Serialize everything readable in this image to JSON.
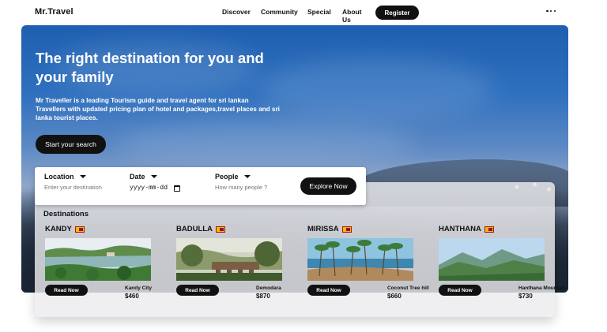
{
  "nav": {
    "brand": "Mr.Travel",
    "links": [
      "Discover",
      "Community",
      "Special",
      "About Us"
    ],
    "register_label": "Register",
    "more_icon": "more-horizontal-icon"
  },
  "hero": {
    "title": "The right destination for you and your family",
    "description": "Mr Traveller is a leading Tourism guide and travel agent for sri lankan Travellers with updated pricing plan of hotel and packages,travel places and sri lanka tourist places.",
    "search_button": "Start your search"
  },
  "search": {
    "location_label": "Location",
    "location_placeholder": "Enter your destination",
    "date_label": "Date",
    "date_value": "yyyy-mm-dd",
    "people_label": "People",
    "people_placeholder": "How many people ?",
    "explore_button": "Explore Now"
  },
  "destinations": {
    "title": "Destinations",
    "read_label": "Read Now",
    "cards": [
      {
        "name": "KANDY",
        "place": "Kandy City",
        "price": "$460"
      },
      {
        "name": "BADULLA",
        "place": "Demodara",
        "price": "$870"
      },
      {
        "name": "MIRISSA",
        "place": "Coconut Tree hill",
        "price": "$660"
      },
      {
        "name": "HANTHANA",
        "place": "Hanthana Mountain",
        "price": "$730"
      }
    ]
  },
  "colors": {
    "button_dark": "#111111",
    "hero_sky": "#2e6fbe",
    "flag_yellow": "#ffb700",
    "flag_maroon": "#8d153a"
  }
}
